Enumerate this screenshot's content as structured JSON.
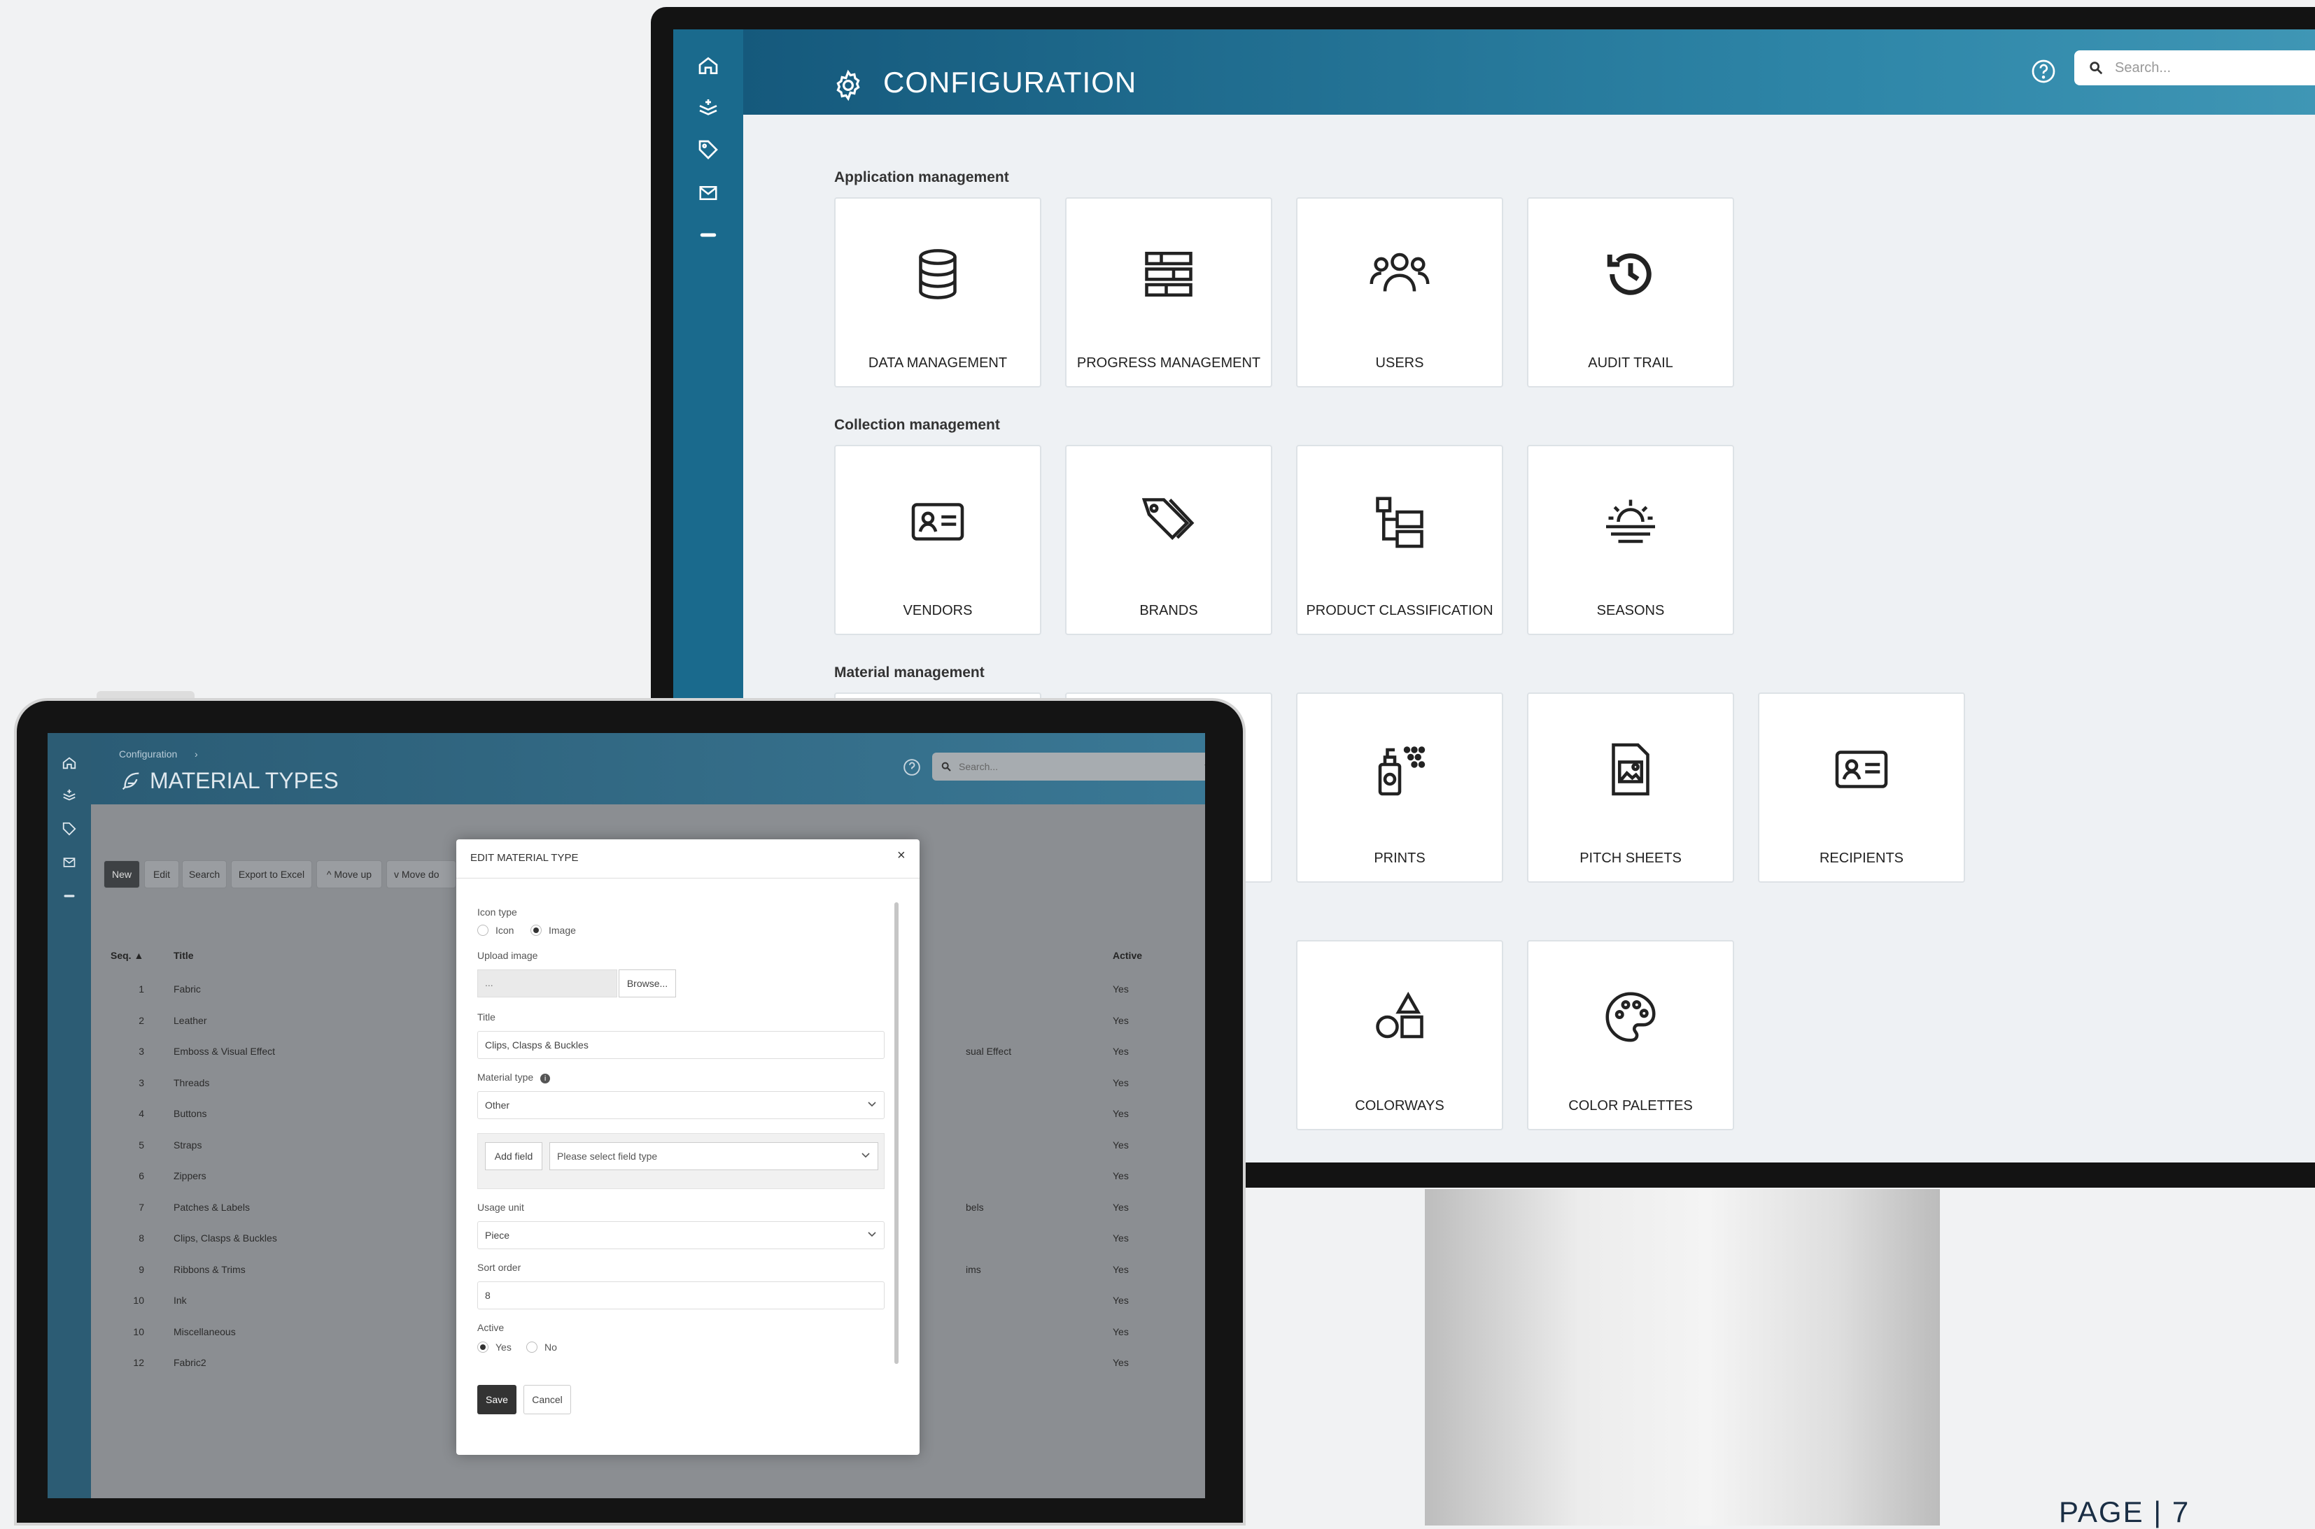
{
  "desktop": {
    "title": "CONFIGURATION",
    "search_placeholder": "Search...",
    "sections": [
      {
        "title": "Application management",
        "tiles": [
          {
            "label": "DATA MANAGEMENT",
            "icon": "database-icon"
          },
          {
            "label": "PROGRESS MANAGEMENT",
            "icon": "progress-bars-icon"
          },
          {
            "label": "USERS",
            "icon": "users-icon"
          },
          {
            "label": "AUDIT TRAIL",
            "icon": "history-icon"
          }
        ]
      },
      {
        "title": "Collection management",
        "tiles": [
          {
            "label": "VENDORS",
            "icon": "vendor-card-icon"
          },
          {
            "label": "BRANDS",
            "icon": "tags-icon"
          },
          {
            "label": "PRODUCT CLASSIFICATION",
            "icon": "hierarchy-icon"
          },
          {
            "label": "SEASONS",
            "icon": "sun-horizon-icon"
          }
        ]
      },
      {
        "title": "Material management",
        "tiles": [
          {
            "label": "PRINTS",
            "icon": "spray-bottle-icon"
          },
          {
            "label": "PITCH SHEETS",
            "icon": "image-document-icon"
          },
          {
            "label": "RECIPIENTS",
            "icon": "contact-card-icon"
          },
          {
            "label": "COLORWAYS",
            "icon": "shapes-icon"
          },
          {
            "label": "COLOR PALETTES",
            "icon": "palette-icon"
          }
        ]
      }
    ]
  },
  "page_label": "PAGE | 7",
  "tablet": {
    "breadcrumb": "Configuration",
    "title": "MATERIAL TYPES",
    "search_placeholder": "Search...",
    "toolbar": [
      "New",
      "Edit",
      "Search",
      "Export to Excel",
      "Move up",
      "Move do"
    ],
    "columns": {
      "seq": "Seq.",
      "title": "Title",
      "active": "Active"
    },
    "rows": [
      {
        "seq": "1",
        "title": "Fabric",
        "type": "",
        "active": "Yes"
      },
      {
        "seq": "2",
        "title": "Leather",
        "type": "",
        "active": "Yes"
      },
      {
        "seq": "3",
        "title": "Emboss & Visual Effect",
        "type": "sual Effect",
        "active": "Yes"
      },
      {
        "seq": "3",
        "title": "Threads",
        "type": "",
        "active": "Yes"
      },
      {
        "seq": "4",
        "title": "Buttons",
        "type": "",
        "active": "Yes"
      },
      {
        "seq": "5",
        "title": "Straps",
        "type": "",
        "active": "Yes"
      },
      {
        "seq": "6",
        "title": "Zippers",
        "type": "",
        "active": "Yes"
      },
      {
        "seq": "7",
        "title": "Patches & Labels",
        "type": "bels",
        "active": "Yes"
      },
      {
        "seq": "8",
        "title": "Clips, Clasps & Buckles",
        "type": "",
        "active": "Yes"
      },
      {
        "seq": "9",
        "title": "Ribbons & Trims",
        "type": "ims",
        "active": "Yes"
      },
      {
        "seq": "10",
        "title": "Ink",
        "type": "",
        "active": "Yes"
      },
      {
        "seq": "10",
        "title": "Miscellaneous",
        "type": "",
        "active": "Yes"
      },
      {
        "seq": "12",
        "title": "Fabric2",
        "type": "",
        "active": "Yes"
      }
    ],
    "modal": {
      "title": "EDIT MATERIAL TYPE",
      "close": "×",
      "icon_type_label": "Icon type",
      "icon_option": "Icon",
      "image_option": "Image",
      "upload_label": "Upload image",
      "upload_value": "...",
      "browse": "Browse...",
      "title_label": "Title",
      "title_value": "Clips, Clasps & Buckles",
      "material_type_label": "Material type",
      "material_type_value": "Other",
      "add_field": "Add field",
      "field_type_placeholder": "Please select field type",
      "usage_unit_label": "Usage unit",
      "usage_unit_value": "Piece",
      "sort_order_label": "Sort order",
      "sort_order_value": "8",
      "active_label": "Active",
      "yes": "Yes",
      "no": "No",
      "save": "Save",
      "cancel": "Cancel"
    }
  }
}
